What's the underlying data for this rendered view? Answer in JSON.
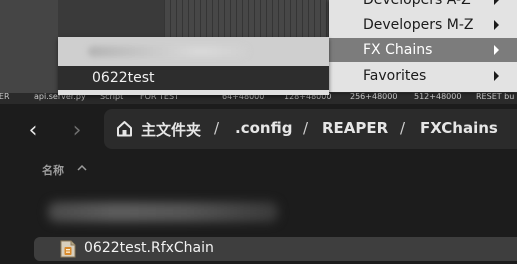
{
  "reaper": {
    "track_labels": [
      "YER",
      "api.server.py",
      "Script",
      "FOR TEST",
      "64+48000",
      "128+48000",
      "256+48000",
      "512+48000",
      "RESET bu"
    ]
  },
  "fx_menu": {
    "items": [
      {
        "label": "Developers A-Z",
        "has_submenu": true
      },
      {
        "label": "Developers M-Z",
        "has_submenu": true
      },
      {
        "label": "FX Chains",
        "has_submenu": true,
        "active": true
      },
      {
        "label": "Favorites",
        "has_submenu": true
      }
    ]
  },
  "fx_chains_menu": {
    "selected_item": "0622test"
  },
  "file_manager": {
    "breadcrumb": [
      "主文件夹",
      ".config",
      "REAPER",
      "FXChains"
    ],
    "separator": "/",
    "column_header": "名称",
    "file_name": "0622test.RfxChain",
    "back_glyph": "‹",
    "forward_glyph": "›"
  },
  "icons": {
    "home": "home-icon",
    "file": "fxchain-file-icon",
    "sort": "sort-ascending-icon"
  }
}
